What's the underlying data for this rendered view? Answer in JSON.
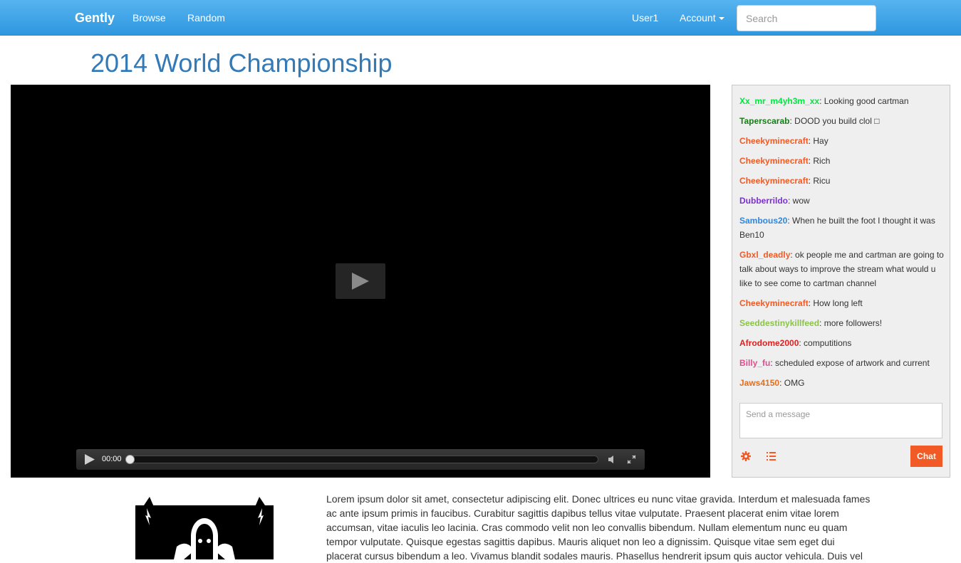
{
  "navbar": {
    "brand": "Gently",
    "links": [
      "Browse",
      "Random"
    ],
    "user": "User1",
    "account": "Account",
    "search_placeholder": "Search"
  },
  "page": {
    "title": "2014 World Championship"
  },
  "player": {
    "time": "00:00",
    "progress": 0
  },
  "chat": {
    "messages": [
      {
        "user": "Xx_mr_m4yh3m_xx",
        "color": "#00e640",
        "text": "Looking good cartman"
      },
      {
        "user": "Taperscarab",
        "color": "#1a7a1a",
        "text": "DOOD you build clol □"
      },
      {
        "user": "Cheekyminecraft",
        "color": "#f15a24",
        "text": "Hay"
      },
      {
        "user": "Cheekyminecraft",
        "color": "#f15a24",
        "text": "Rich"
      },
      {
        "user": "Cheekyminecraft",
        "color": "#f15a24",
        "text": "Ricu"
      },
      {
        "user": "Dubberrildo",
        "color": "#7b2fd4",
        "text": "wow"
      },
      {
        "user": "Sambous20",
        "color": "#2e86de",
        "text": "When he built the foot I thought it was Ben10"
      },
      {
        "user": "Gbxl_deadly",
        "color": "#f15a24",
        "text": "ok people me and cartman are going to talk about ways to improve the stream what would u like to see come to cartman channel"
      },
      {
        "user": "Cheekyminecraft",
        "color": "#f15a24",
        "text": "How long left"
      },
      {
        "user": "Seeddestinykillfeed",
        "color": "#8bc34a",
        "text": "more followers!"
      },
      {
        "user": "Afrodome2000",
        "color": "#e02020",
        "text": "computitions"
      },
      {
        "user": "Billy_fu",
        "color": "#e84a8f",
        "text": "scheduled expose of artwork and current"
      },
      {
        "user": "Jaws4150",
        "color": "#e07020",
        "text": "OMG"
      }
    ],
    "input_placeholder": "Send a message",
    "send_label": "Chat",
    "accent": "#f15a24"
  },
  "description": "Lorem ipsum dolor sit amet, consectetur adipiscing elit. Donec ultrices eu nunc vitae gravida. Interdum et malesuada fames ac ante ipsum primis in faucibus. Curabitur sagittis dapibus tellus vitae vulputate. Praesent placerat enim vitae lorem accumsan, vitae iaculis leo lacinia. Cras commodo velit non leo convallis bibendum. Nullam elementum nunc eu quam tempor vulputate. Quisque egestas sagittis dapibus. Mauris aliquet non leo a dignissim. Quisque vitae sem eget dui placerat cursus bibendum a leo. Vivamus blandit sodales mauris. Phasellus hendrerit ipsum quis auctor vehicula. Duis vel"
}
